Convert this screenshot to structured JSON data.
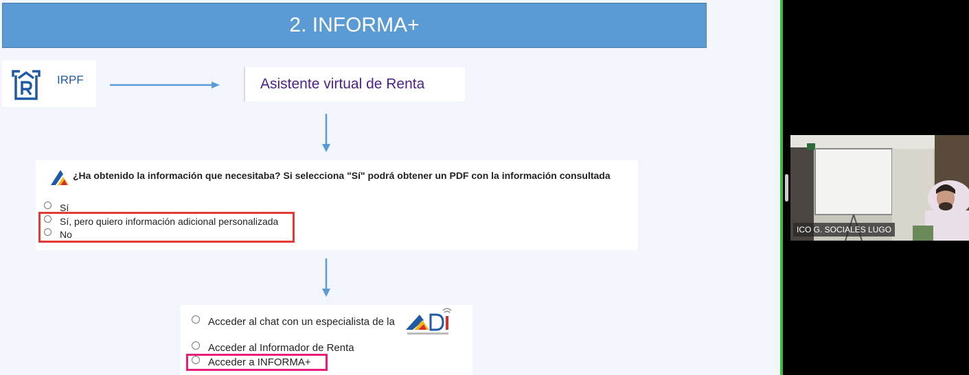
{
  "slide": {
    "title": "2. INFORMA+",
    "irpf_label": "IRPF",
    "assistant_label": "Asistente virtual de Renta",
    "question": {
      "text": "¿Ha obtenido la información que necesitaba? Si selecciona \"Sí\" podrá obtener un PDF con la información consultada",
      "options": [
        "Sí",
        "Sí, pero quiero información adicional personalizada",
        "No"
      ]
    },
    "access": {
      "options": [
        "Acceder al chat con un especialista de la",
        "Acceder al Informador de Renta",
        "Acceder a INFORMA+"
      ]
    },
    "colors": {
      "banner": "#5b9bd5",
      "highlight_red": "#e53935",
      "highlight_pink": "#e91e7a",
      "assistant_text": "#4b1f8a"
    }
  },
  "video": {
    "participant_name": "ICO G. SOCIALES LUGO"
  }
}
